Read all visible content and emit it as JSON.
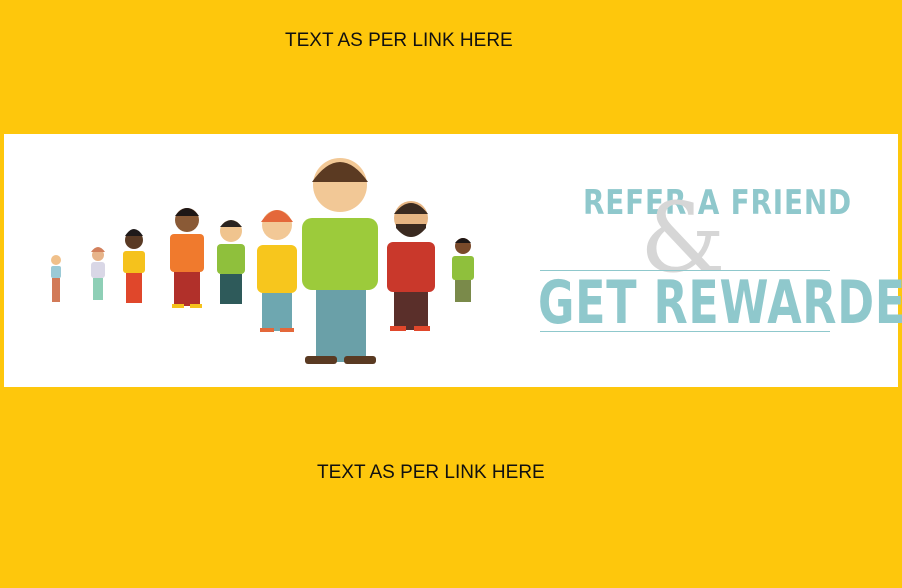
{
  "top_text": "TEXT AS PER LINK HERE",
  "bottom_text": "TEXT AS PER LINK HERE",
  "banner": {
    "headline_1": "REFER A FRIEND",
    "ampersand": "&",
    "headline_2": "GET REWARDED"
  },
  "colors": {
    "background": "#fec70c",
    "banner_bg": "#ffffff",
    "headline": "#8fc8cc"
  },
  "illustration": "people-group-icon"
}
